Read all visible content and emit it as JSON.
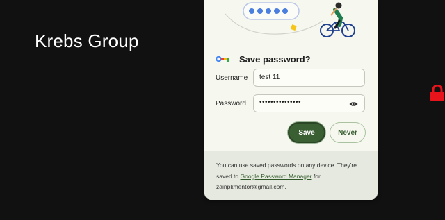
{
  "page": {
    "site_title": "Krebs Group"
  },
  "dialog": {
    "title": "Save password?",
    "username_label": "Username",
    "username_value": "test 11",
    "password_label": "Password",
    "password_value": "•••••••••••••••",
    "save_label": "Save",
    "never_label": "Never",
    "footer": {
      "text_before": "You can use saved passwords on any device. They're saved to ",
      "link": "Google Password Manager",
      "text_after": " for zainpkmentor@gmail.com."
    }
  },
  "colors": {
    "page_bg": "#111111",
    "dialog_bg": "#f6f7ef",
    "accent": "#3a5f33",
    "lock": "#e8141b"
  }
}
